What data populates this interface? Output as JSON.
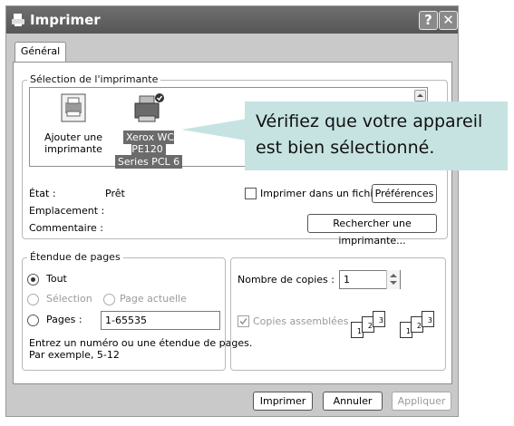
{
  "window": {
    "title": "Imprimer",
    "help_button": "?",
    "close_button": "✕"
  },
  "tabs": [
    {
      "label": "Général"
    }
  ],
  "printer_selection": {
    "group_label": "Sélection de l'imprimante",
    "printers": [
      {
        "label_line1": "Ajouter une",
        "label_line2": "imprimante"
      },
      {
        "label_line1": "Xerox WC PE120",
        "label_line2": "Series PCL 6",
        "selected": true
      }
    ],
    "callout": "Vérifiez que votre appareil est bien sélectionné."
  },
  "status": {
    "etat_label": "État :",
    "etat_value": "Prêt",
    "emplacement_label": "Emplacement :",
    "commentaire_label": "Commentaire :",
    "print_to_file_label": "Imprimer dans un fichier",
    "preferences_button": "Préférences",
    "find_printer_button": "Rechercher une imprimante..."
  },
  "page_range": {
    "group_label": "Étendue de pages",
    "tout_label": "Tout",
    "selection_label": "Sélection",
    "page_actuelle_label": "Page actuelle",
    "pages_label": "Pages :",
    "pages_value": "1-65535",
    "hint_line1": "Entrez un numéro ou une étendue de pages.",
    "hint_line2": "Par exemple, 5-12"
  },
  "copies": {
    "count_label": "Nombre de copies :",
    "count_value": "1",
    "collate_label": "Copies assemblées"
  },
  "footer": {
    "print_button": "Imprimer",
    "cancel_button": "Annuler",
    "apply_button": "Appliquer"
  }
}
